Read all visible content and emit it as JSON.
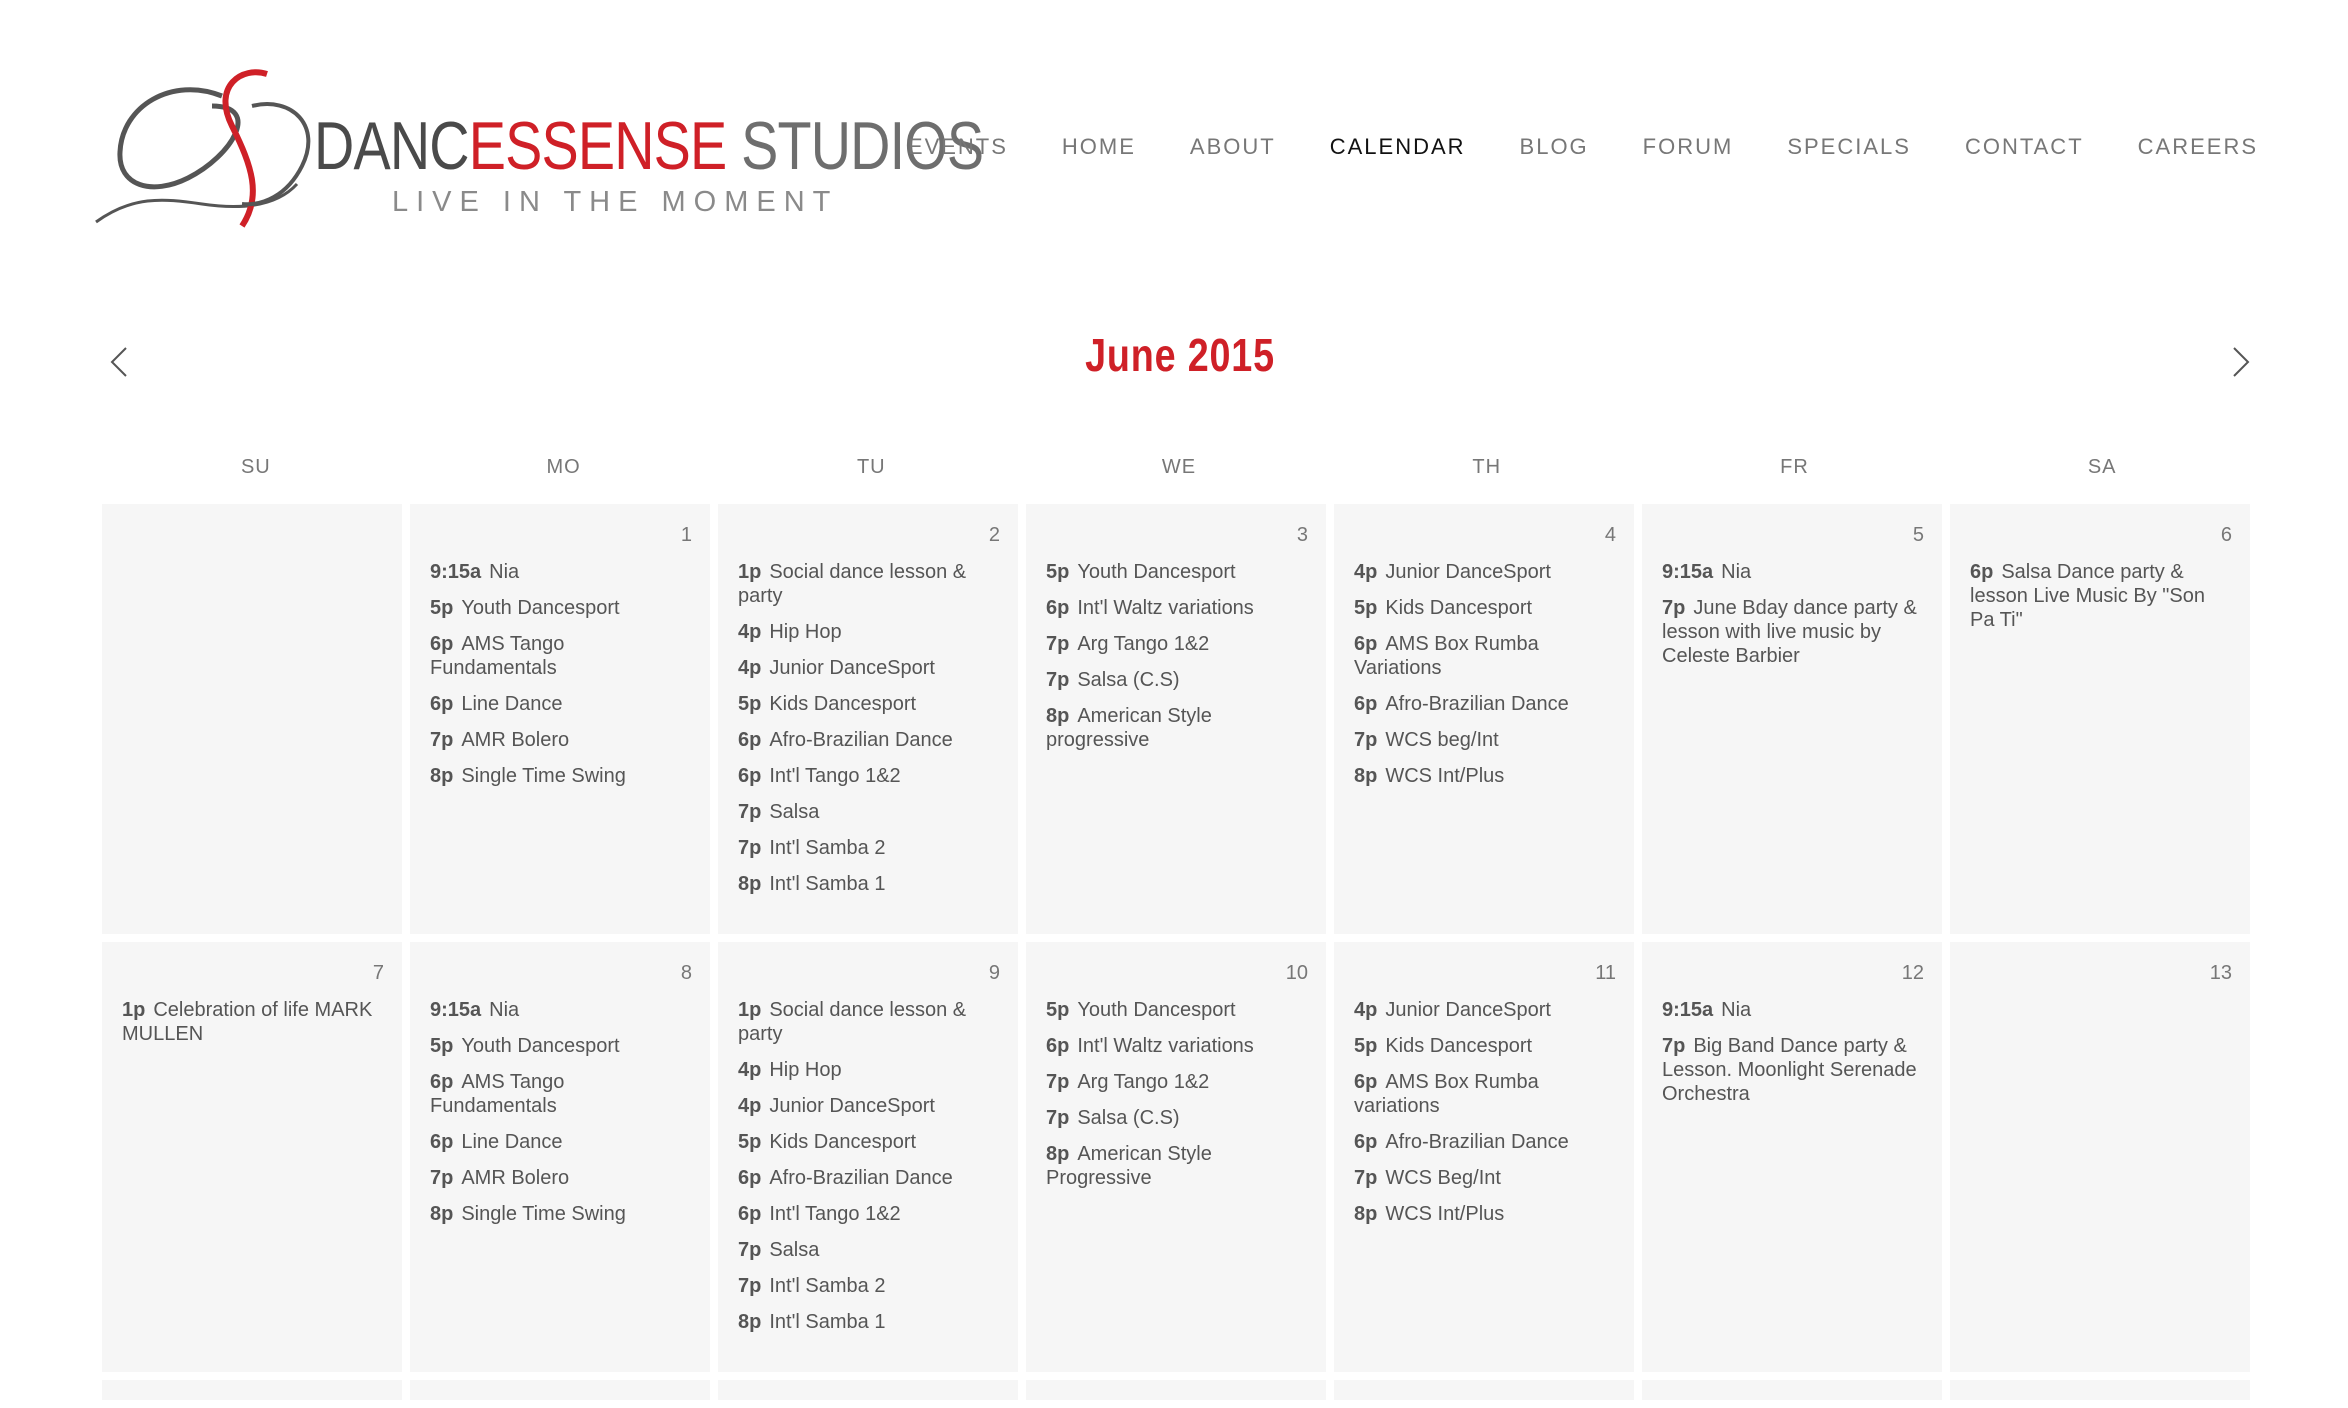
{
  "brand": {
    "name_part1": "DANC",
    "name_part2": "ESSENSE",
    "name_part3": " STUDIOS",
    "tagline": "LIVE IN THE MOMENT",
    "colors": {
      "red": "#cf2027",
      "dark": "#4a4a4a",
      "grey": "#6e6e6e"
    }
  },
  "nav": [
    {
      "label": "EVENTS",
      "active": false
    },
    {
      "label": "HOME",
      "active": false
    },
    {
      "label": "ABOUT",
      "active": false
    },
    {
      "label": "CALENDAR",
      "active": true
    },
    {
      "label": "BLOG",
      "active": false
    },
    {
      "label": "FORUM",
      "active": false
    },
    {
      "label": "SPECIALS",
      "active": false
    },
    {
      "label": "CONTACT",
      "active": false
    },
    {
      "label": "CAREERS",
      "active": false
    }
  ],
  "calendar": {
    "month_title": "June 2015",
    "prev_icon": "chevron-left-icon",
    "next_icon": "chevron-right-icon",
    "weekdays": [
      "SU",
      "MO",
      "TU",
      "WE",
      "TH",
      "FR",
      "SA"
    ],
    "weeks": [
      [
        {
          "date": "",
          "events": []
        },
        {
          "date": "1",
          "events": [
            {
              "time": "9:15a",
              "title": "Nia"
            },
            {
              "time": "5p",
              "title": "Youth Dancesport"
            },
            {
              "time": "6p",
              "title": "AMS Tango Fundamentals"
            },
            {
              "time": "6p",
              "title": "Line Dance"
            },
            {
              "time": "7p",
              "title": "AMR Bolero"
            },
            {
              "time": "8p",
              "title": "Single Time Swing"
            }
          ]
        },
        {
          "date": "2",
          "events": [
            {
              "time": "1p",
              "title": "Social dance lesson & party"
            },
            {
              "time": "4p",
              "title": "Hip Hop"
            },
            {
              "time": "4p",
              "title": "Junior DanceSport"
            },
            {
              "time": "5p",
              "title": "Kids Dancesport"
            },
            {
              "time": "6p",
              "title": "Afro-Brazilian Dance"
            },
            {
              "time": "6p",
              "title": "Int'l Tango 1&2"
            },
            {
              "time": "7p",
              "title": "Salsa"
            },
            {
              "time": "7p",
              "title": "Int'l Samba 2"
            },
            {
              "time": "8p",
              "title": "Int'l Samba 1"
            }
          ]
        },
        {
          "date": "3",
          "events": [
            {
              "time": "5p",
              "title": "Youth Dancesport"
            },
            {
              "time": "6p",
              "title": "Int'l Waltz variations"
            },
            {
              "time": "7p",
              "title": "Arg Tango 1&2"
            },
            {
              "time": "7p",
              "title": "Salsa (C.S)"
            },
            {
              "time": "8p",
              "title": "American Style progressive"
            }
          ]
        },
        {
          "date": "4",
          "events": [
            {
              "time": "4p",
              "title": "Junior DanceSport"
            },
            {
              "time": "5p",
              "title": "Kids Dancesport"
            },
            {
              "time": "6p",
              "title": "AMS Box Rumba Variations"
            },
            {
              "time": "6p",
              "title": "Afro-Brazilian Dance"
            },
            {
              "time": "7p",
              "title": "WCS beg/Int"
            },
            {
              "time": "8p",
              "title": "WCS Int/Plus"
            }
          ]
        },
        {
          "date": "5",
          "events": [
            {
              "time": "9:15a",
              "title": "Nia"
            },
            {
              "time": "7p",
              "title": "June Bday dance party & lesson with live music by Celeste Barbier"
            }
          ]
        },
        {
          "date": "6",
          "events": [
            {
              "time": "6p",
              "title": "Salsa Dance party & lesson Live Music By \"Son Pa Ti\""
            }
          ]
        }
      ],
      [
        {
          "date": "7",
          "events": [
            {
              "time": "1p",
              "title": "Celebration of life MARK MULLEN"
            }
          ]
        },
        {
          "date": "8",
          "events": [
            {
              "time": "9:15a",
              "title": "Nia"
            },
            {
              "time": "5p",
              "title": "Youth Dancesport"
            },
            {
              "time": "6p",
              "title": "AMS Tango Fundamentals"
            },
            {
              "time": "6p",
              "title": "Line Dance"
            },
            {
              "time": "7p",
              "title": "AMR Bolero"
            },
            {
              "time": "8p",
              "title": "Single Time Swing"
            }
          ]
        },
        {
          "date": "9",
          "events": [
            {
              "time": "1p",
              "title": "Social dance lesson & party"
            },
            {
              "time": "4p",
              "title": "Hip Hop"
            },
            {
              "time": "4p",
              "title": "Junior DanceSport"
            },
            {
              "time": "5p",
              "title": "Kids Dancesport"
            },
            {
              "time": "6p",
              "title": "Afro-Brazilian Dance"
            },
            {
              "time": "6p",
              "title": "Int'l Tango 1&2"
            },
            {
              "time": "7p",
              "title": "Salsa"
            },
            {
              "time": "7p",
              "title": "Int'l Samba 2"
            },
            {
              "time": "8p",
              "title": "Int'l Samba 1"
            }
          ]
        },
        {
          "date": "10",
          "events": [
            {
              "time": "5p",
              "title": "Youth Dancesport"
            },
            {
              "time": "6p",
              "title": "Int'l Waltz variations"
            },
            {
              "time": "7p",
              "title": "Arg Tango 1&2"
            },
            {
              "time": "7p",
              "title": "Salsa (C.S)"
            },
            {
              "time": "8p",
              "title": "American Style Progressive"
            }
          ]
        },
        {
          "date": "11",
          "events": [
            {
              "time": "4p",
              "title": "Junior DanceSport"
            },
            {
              "time": "5p",
              "title": "Kids Dancesport"
            },
            {
              "time": "6p",
              "title": "AMS Box Rumba variations"
            },
            {
              "time": "6p",
              "title": "Afro-Brazilian Dance"
            },
            {
              "time": "7p",
              "title": "WCS Beg/Int"
            },
            {
              "time": "8p",
              "title": "WCS Int/Plus"
            }
          ]
        },
        {
          "date": "12",
          "events": [
            {
              "time": "9:15a",
              "title": "Nia"
            },
            {
              "time": "7p",
              "title": "Big Band Dance party & Lesson. Moonlight Serenade Orchestra"
            }
          ]
        },
        {
          "date": "13",
          "events": []
        }
      ],
      [
        {
          "date": "",
          "events": []
        },
        {
          "date": "",
          "events": []
        },
        {
          "date": "",
          "events": []
        },
        {
          "date": "",
          "events": []
        },
        {
          "date": "",
          "events": []
        },
        {
          "date": "",
          "events": []
        },
        {
          "date": "",
          "events": []
        }
      ]
    ]
  }
}
